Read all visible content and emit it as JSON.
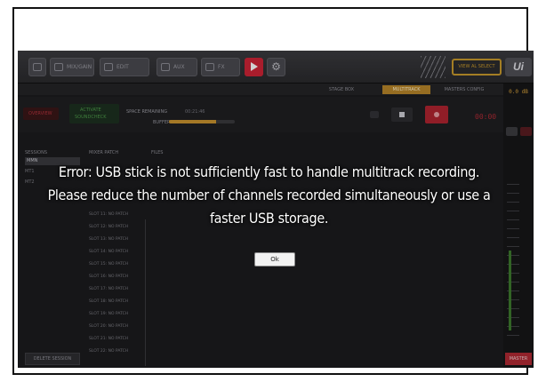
{
  "toolbar": {
    "buttons": [
      {
        "label": "MIX/GAIN",
        "icon": "mixer-icon"
      },
      {
        "label": "EDIT",
        "icon": "edit-icon"
      },
      {
        "label": "AUX",
        "icon": "aux-icon"
      },
      {
        "label": "FX",
        "icon": "fx-icon"
      }
    ],
    "view_label": "VIEW AL SELECT",
    "logo": "Ui"
  },
  "tabs": [
    {
      "label": "STAGE BOX",
      "active": false
    },
    {
      "label": "MULTITRACK",
      "active": true
    },
    {
      "label": "MASTERS CONFIG",
      "active": false
    }
  ],
  "db_readout": "0.0 dB",
  "transport": {
    "overview": "OVERVIEW",
    "activate": "ACTIVATE",
    "soundcheck": "SOUNDCHECK",
    "space_remaining_label": "SPACE REMAINING",
    "space_remaining_value": "00:21:46",
    "buffer_label": "BUFFER",
    "buffer_level": 0.72,
    "time": "00:00"
  },
  "lists": {
    "sessions_header": "SESSIONS",
    "mixer_patch_header": "MIXER PATCH",
    "files_header": "FILES",
    "sessions": [
      "MMN",
      "MT1",
      "MT2"
    ],
    "slots": [
      "SLOT 11: NO PATCH",
      "SLOT 12: NO PATCH",
      "SLOT 13: NO PATCH",
      "SLOT 14: NO PATCH",
      "SLOT 15: NO PATCH",
      "SLOT 16: NO PATCH",
      "SLOT 17: NO PATCH",
      "SLOT 18: NO PATCH",
      "SLOT 19: NO PATCH",
      "SLOT 20: NO PATCH",
      "SLOT 21: NO PATCH",
      "SLOT 22: NO PATCH"
    ],
    "delete_label": "DELETE SESSION"
  },
  "master_label": "MASTER",
  "dialog": {
    "line1": "Error: USB stick is not sufficiently fast to handle multitrack recording.",
    "line2": "Please reduce the number of channels recorded simultaneously or use a",
    "line3": "faster USB storage.",
    "ok_label": "Ok"
  },
  "colors": {
    "accent": "#b8862a",
    "record_red": "#cf2436",
    "background": "#1c1c1e"
  }
}
